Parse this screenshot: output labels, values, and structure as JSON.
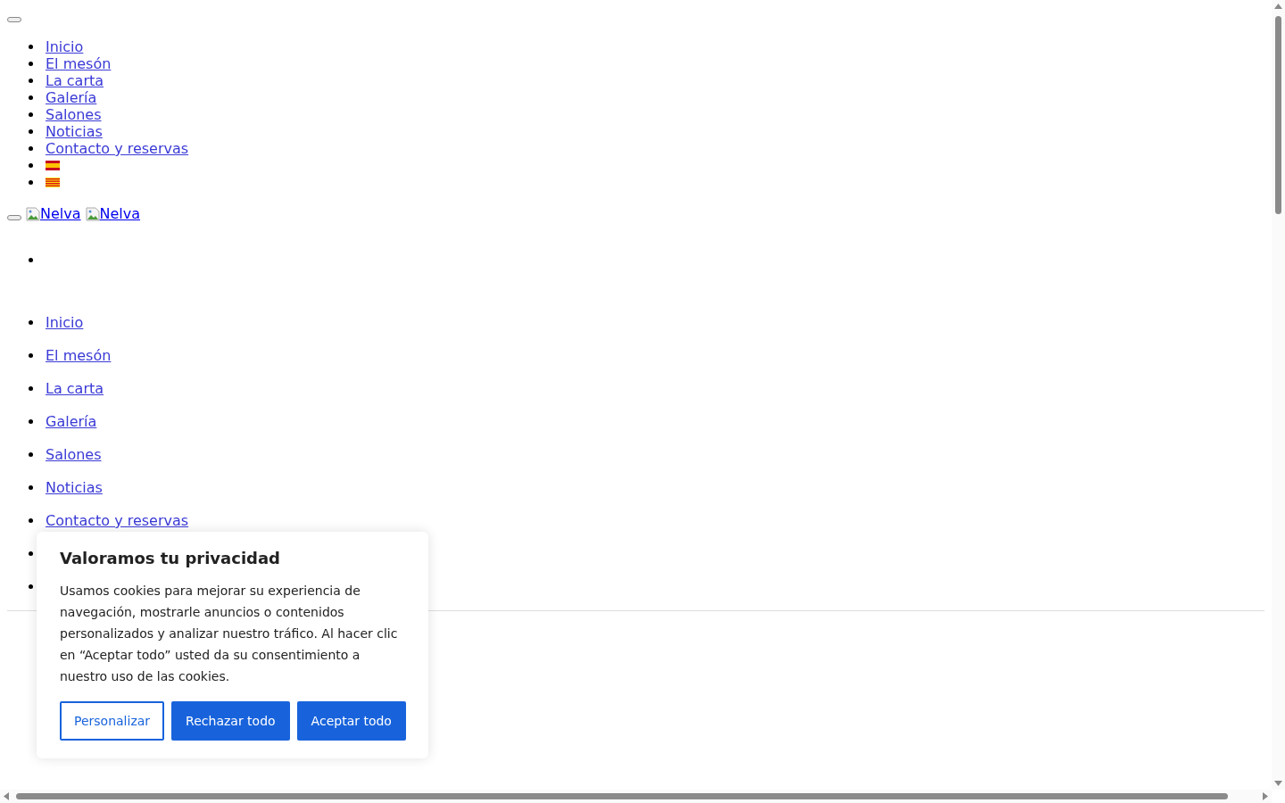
{
  "top_menu": [
    {
      "kind": "link",
      "label": "Inicio"
    },
    {
      "kind": "link",
      "label": "El mesón"
    },
    {
      "kind": "link",
      "label": "La carta"
    },
    {
      "kind": "link",
      "label": "Galería"
    },
    {
      "kind": "link",
      "label": "Salones"
    },
    {
      "kind": "link",
      "label": "Noticias"
    },
    {
      "kind": "link",
      "label": "Contacto y reservas"
    },
    {
      "kind": "es_flag"
    },
    {
      "kind": "ca_flag"
    }
  ],
  "logo": {
    "alt_texts": [
      "Nelva",
      "Nelva"
    ]
  },
  "main_menu": [
    {
      "label": "Inicio"
    },
    {
      "label": "El mesón"
    },
    {
      "label": "La carta"
    },
    {
      "label": "Galería"
    },
    {
      "label": "Salones"
    },
    {
      "label": "Noticias"
    },
    {
      "label": "Contacto y reservas"
    }
  ],
  "cookie_banner": {
    "title": "Valoramos tu privacidad",
    "text": "Usamos cookies para mejorar su experiencia de navegación, mostrarle anuncios o contenidos personalizados y analizar nuestro tráfico. Al hacer clic en “Aceptar todo” usted da su consentimiento a nuestro uso de las cookies.",
    "buttons": [
      {
        "kind": "outline",
        "label": "Personalizar"
      },
      {
        "kind": "filled",
        "label": "Rechazar todo"
      },
      {
        "kind": "filled",
        "label": "Aceptar todo"
      }
    ]
  }
}
